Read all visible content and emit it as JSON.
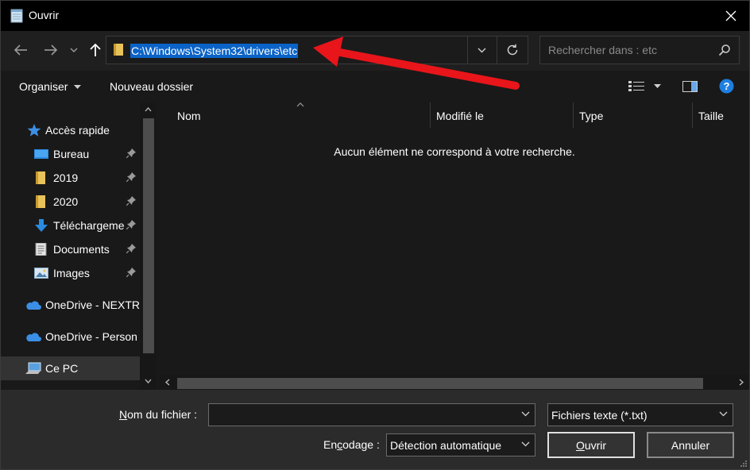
{
  "window": {
    "title": "Ouvrir",
    "close_icon": "close-icon"
  },
  "address": {
    "path": "C:\\Windows\\System32\\drivers\\etc"
  },
  "search": {
    "placeholder": "Rechercher dans : etc"
  },
  "toolbar": {
    "organize_label": "Organiser",
    "new_folder_label": "Nouveau dossier"
  },
  "nav": {
    "quick_access": "Accès rapide",
    "items": [
      {
        "label": "Bureau",
        "icon": "desktop-icon",
        "pinned": true
      },
      {
        "label": "2019",
        "icon": "folder-icon",
        "pinned": true
      },
      {
        "label": "2020",
        "icon": "folder-icon",
        "pinned": true
      },
      {
        "label": "Téléchargements",
        "icon": "download-icon",
        "pinned": true
      },
      {
        "label": "Documents",
        "icon": "documents-icon",
        "pinned": true
      },
      {
        "label": "Images",
        "icon": "images-icon",
        "pinned": true
      }
    ],
    "onedrive_business": "OneDrive - NEXTR",
    "onedrive_personal": "OneDrive - Person",
    "this_pc": "Ce PC"
  },
  "columns": {
    "name": "Nom",
    "modified": "Modifié le",
    "type": "Type",
    "size": "Taille"
  },
  "content": {
    "empty_message": "Aucun élément ne correspond à votre recherche."
  },
  "bottom": {
    "filename_label_u": "N",
    "filename_label_rest": "om du fichier :",
    "filename_value": "",
    "filter_value": "Fichiers texte (*.txt)",
    "encoding_label_pre": "En",
    "encoding_label_u": "c",
    "encoding_label_rest": "odage :",
    "encoding_value": "Détection automatique",
    "open_label_pre": "",
    "open_label_u": "O",
    "open_label_rest": "uvrir",
    "cancel_label": "Annuler"
  },
  "colors": {
    "selection": "#0b63c7",
    "annotation_arrow": "#e8151a",
    "help_icon": "#1e7fe0",
    "folder": "#e8c25a",
    "onedrive": "#3b8ee6"
  }
}
